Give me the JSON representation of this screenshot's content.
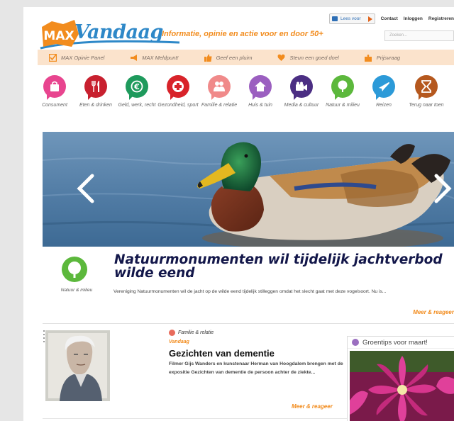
{
  "header": {
    "logo_max": "MAX",
    "logo_vandaag": "Vandaag",
    "tagline": "Informatie, opinie en actie voor en door 50+",
    "lees_voor": "Lees voor",
    "links": [
      "Contact",
      "Inloggen",
      "Registreren"
    ],
    "search_placeholder": "Zoeken..."
  },
  "orange_bar": {
    "items": [
      {
        "label": "MAX Opinie Panel",
        "icon": "checkbox-icon"
      },
      {
        "label": "MAX Meldpunt!",
        "icon": "megaphone-icon"
      },
      {
        "label": "Geef een pluim",
        "icon": "thumbs-up-icon"
      },
      {
        "label": "Steun een goed doel",
        "icon": "heart-icon"
      },
      {
        "label": "Prijsvraag",
        "icon": "puzzle-icon"
      }
    ]
  },
  "categories": [
    {
      "label": "Consument",
      "color": "#e8458f",
      "icon": "shopping-bag-icon"
    },
    {
      "label": "Eten & drinken",
      "color": "#c8202f",
      "icon": "fork-knife-icon"
    },
    {
      "label": "Geld, werk, recht",
      "color": "#1e9a5c",
      "icon": "euro-icon"
    },
    {
      "label": "Gezondheid, sport",
      "color": "#d8232a",
      "icon": "medical-cross-icon"
    },
    {
      "label": "Familie & relatie",
      "color": "#f08a8a",
      "icon": "family-icon"
    },
    {
      "label": "Huis & tuin",
      "color": "#9b5fc0",
      "icon": "house-icon"
    },
    {
      "label": "Media & cultuur",
      "color": "#4b2e83",
      "icon": "camera-icon"
    },
    {
      "label": "Natuur & milieu",
      "color": "#5cb83c",
      "icon": "tree-icon"
    },
    {
      "label": "Reizen",
      "color": "#2c9ad8",
      "icon": "airplane-icon"
    },
    {
      "label": "Terug naar toen",
      "color": "#b5581e",
      "icon": "hourglass-icon"
    }
  ],
  "featured": {
    "category": "Natuur & milieu",
    "title": "Natuurmonumenten wil tijdelijk jachtverbod wilde eend",
    "summary": "Vereniging Natuurmonumenten wil de jacht op de wilde eend tijdelijk stilleggen omdat het slecht gaat met deze vogelsoort. Nu is...",
    "more": "Meer & reageer"
  },
  "secondary": {
    "category": "Familie & relatie",
    "date": "Vandaag",
    "title": "Gezichten van dementie",
    "summary": "Filmer Gijs Wanders en kunstenaar Herman van Hoogdalem brengen met de expositie Gezichten van dementie de persoon achter de ziekte...",
    "more": "Meer & reageer"
  },
  "sidebox": {
    "title": "Groentips voor maart!"
  },
  "colors": {
    "brand_blue": "#2e88c8",
    "brand_orange": "#f28c1e",
    "headline_navy": "#13174a"
  }
}
